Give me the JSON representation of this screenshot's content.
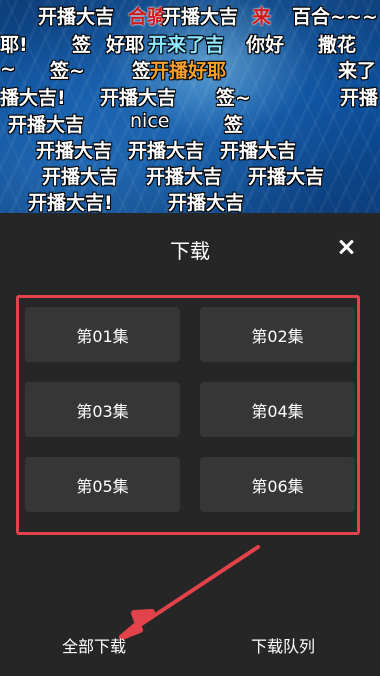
{
  "danmaku": [
    {
      "text": "开播大吉",
      "style": ""
    },
    {
      "text": "合骑",
      "style": "red"
    },
    {
      "text": "开播大吉",
      "style": ""
    },
    {
      "text": "来",
      "style": "red"
    },
    {
      "text": "百合~~~",
      "style": ""
    },
    {
      "text": "耶!",
      "style": ""
    },
    {
      "text": "签",
      "style": ""
    },
    {
      "text": "好耶",
      "style": ""
    },
    {
      "text": "开来了吉",
      "style": "cyan"
    },
    {
      "text": "你好",
      "style": ""
    },
    {
      "text": "撒花",
      "style": ""
    },
    {
      "text": "~",
      "style": ""
    },
    {
      "text": "签~",
      "style": ""
    },
    {
      "text": "签",
      "style": ""
    },
    {
      "text": "开播好耶",
      "style": "orange"
    },
    {
      "text": "来了",
      "style": ""
    },
    {
      "text": "播大吉!",
      "style": ""
    },
    {
      "text": "开播大吉",
      "style": ""
    },
    {
      "text": "签~",
      "style": ""
    },
    {
      "text": "开播",
      "style": ""
    },
    {
      "text": "开播大吉",
      "style": ""
    },
    {
      "text": "nice",
      "style": "thin"
    },
    {
      "text": "签",
      "style": ""
    },
    {
      "text": "开播大吉",
      "style": ""
    },
    {
      "text": "开播大吉",
      "style": ""
    },
    {
      "text": "开播大吉",
      "style": ""
    },
    {
      "text": "开播大吉",
      "style": ""
    },
    {
      "text": "开播大吉",
      "style": ""
    },
    {
      "text": "开播大吉",
      "style": ""
    },
    {
      "text": "开播大吉!",
      "style": ""
    },
    {
      "text": "开播大吉",
      "style": ""
    }
  ],
  "dialog": {
    "title": "下载",
    "close_label": "✕",
    "episodes": [
      "第01集",
      "第02集",
      "第03集",
      "第04集",
      "第05集",
      "第06集"
    ],
    "download_all": "全部下载",
    "download_queue": "下载队列"
  },
  "colors": {
    "panel_bg": "#262626",
    "episode_bg": "#363636",
    "highlight_border": "#e2424a"
  }
}
